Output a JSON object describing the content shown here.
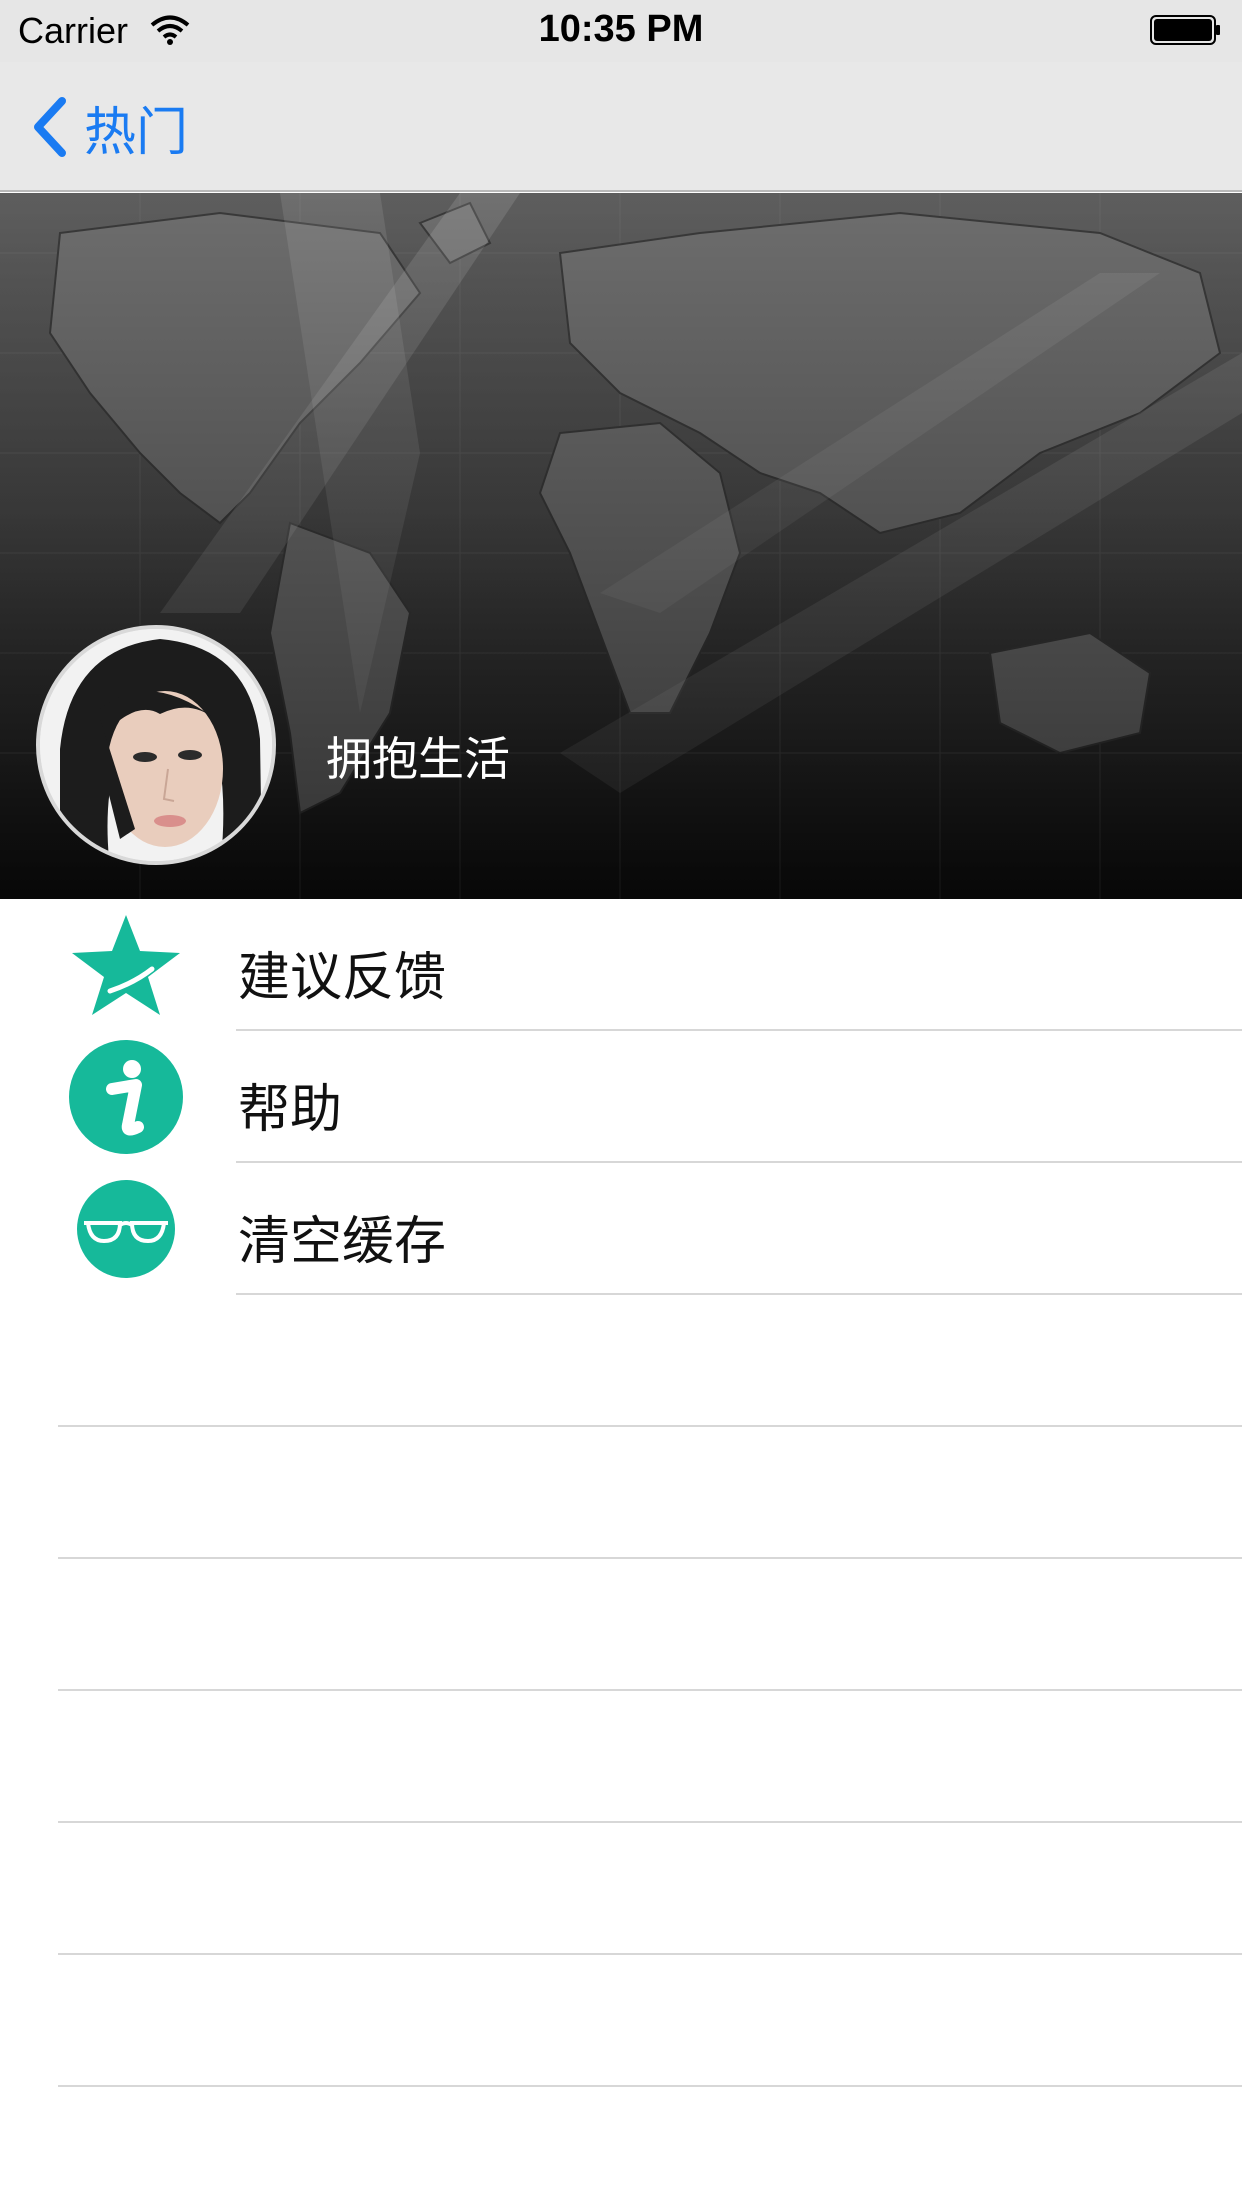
{
  "status_bar": {
    "carrier": "Carrier",
    "time": "10:35 PM",
    "wifi_icon": "wifi-icon",
    "battery_icon": "battery-icon"
  },
  "nav": {
    "back_label": "热门",
    "back_icon": "chevron-left-icon"
  },
  "header": {
    "user_name": "拥抱生活",
    "avatar": "avatar"
  },
  "menu": {
    "items": [
      {
        "label": "建议反馈",
        "icon": "star-icon"
      },
      {
        "label": "帮助",
        "icon": "info-icon"
      },
      {
        "label": "清空缓存",
        "icon": "glasses-icon"
      }
    ]
  },
  "colors": {
    "accent": "#1a7bf2",
    "icon_teal": "#16b99a",
    "separator": "#d7d7d7"
  }
}
